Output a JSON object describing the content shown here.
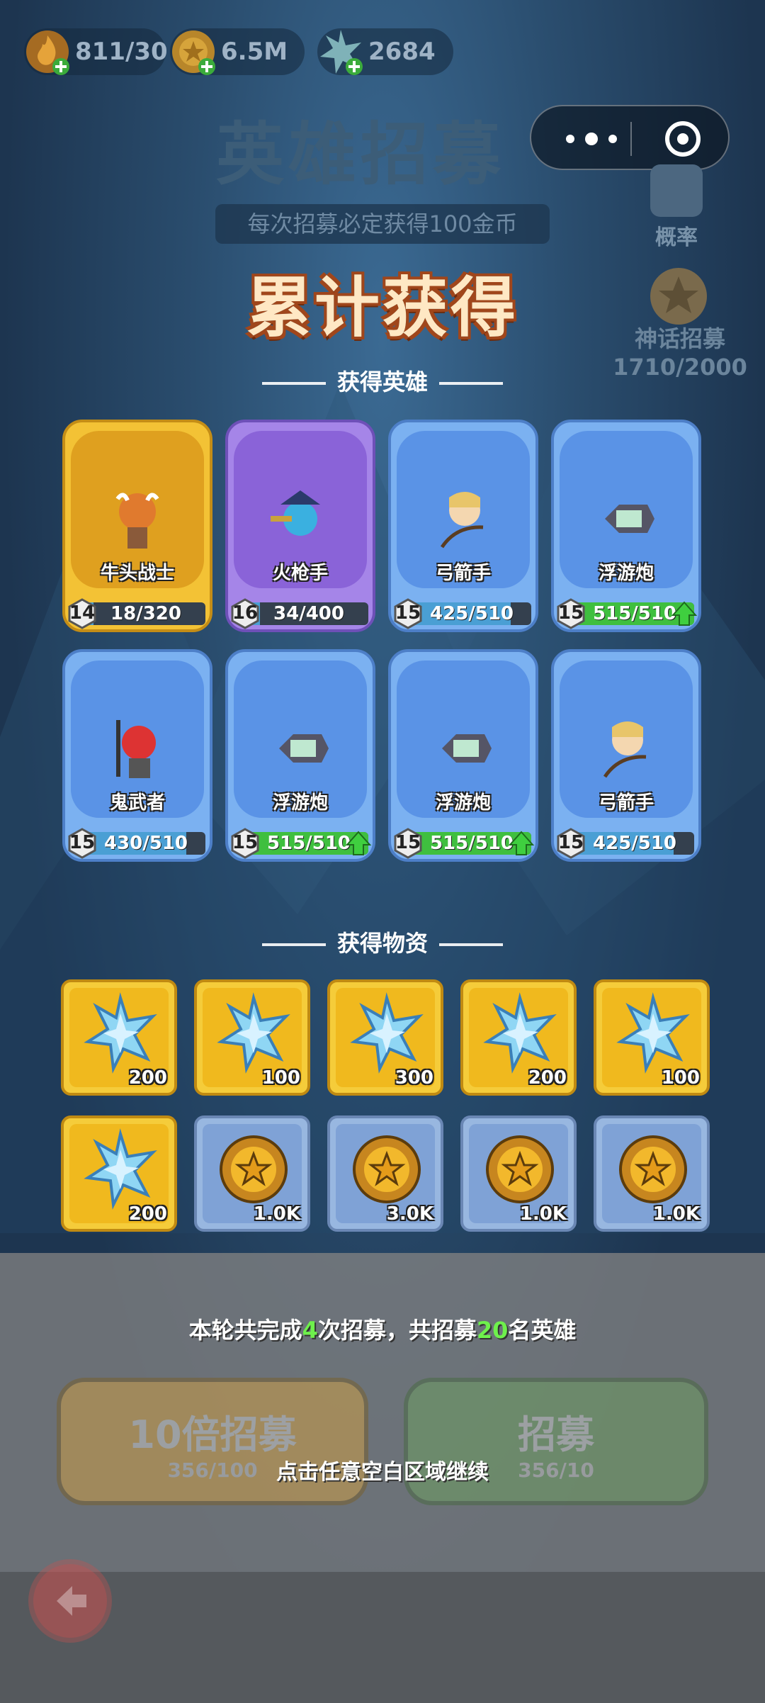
{
  "resources": {
    "stamina": "811/30",
    "coins": "6.5M",
    "crystals": "2684"
  },
  "background": {
    "title": "英雄招募",
    "subtitle": "每次招募必定获得100金币",
    "prob_label": "概率",
    "mythic_label": "神话招募",
    "mythic_progress": "1710/2000"
  },
  "main_title": "累计获得",
  "heroes_section": "获得英雄",
  "items_section": "获得物资",
  "heroes": [
    {
      "name": "牛头战士",
      "level": "14",
      "progress": "18/320",
      "fill": 0.06,
      "rarity": "gold",
      "upgrade": false
    },
    {
      "name": "火枪手",
      "level": "16",
      "progress": "34/400",
      "fill": 0.09,
      "rarity": "purple",
      "upgrade": false
    },
    {
      "name": "弓箭手",
      "level": "15",
      "progress": "425/510",
      "fill": 0.83,
      "rarity": "blue",
      "upgrade": false
    },
    {
      "name": "浮游炮",
      "level": "15",
      "progress": "515/510",
      "fill": 1.0,
      "rarity": "blue",
      "upgrade": true
    },
    {
      "name": "鬼武者",
      "level": "15",
      "progress": "430/510",
      "fill": 0.84,
      "rarity": "blue",
      "upgrade": false
    },
    {
      "name": "浮游炮",
      "level": "15",
      "progress": "515/510",
      "fill": 1.0,
      "rarity": "blue",
      "upgrade": true
    },
    {
      "name": "浮游炮",
      "level": "15",
      "progress": "515/510",
      "fill": 1.0,
      "rarity": "blue",
      "upgrade": true
    },
    {
      "name": "弓箭手",
      "level": "15",
      "progress": "425/510",
      "fill": 0.83,
      "rarity": "blue",
      "upgrade": false
    }
  ],
  "items": [
    {
      "type": "crystal",
      "qty": "200",
      "tile": "gold"
    },
    {
      "type": "crystal",
      "qty": "100",
      "tile": "gold"
    },
    {
      "type": "crystal",
      "qty": "300",
      "tile": "gold"
    },
    {
      "type": "crystal",
      "qty": "200",
      "tile": "gold"
    },
    {
      "type": "crystal",
      "qty": "100",
      "tile": "gold"
    },
    {
      "type": "crystal",
      "qty": "200",
      "tile": "gold"
    },
    {
      "type": "coin",
      "qty": "1.0K",
      "tile": "blue"
    },
    {
      "type": "coin",
      "qty": "3.0K",
      "tile": "blue"
    },
    {
      "type": "coin",
      "qty": "1.0K",
      "tile": "blue"
    },
    {
      "type": "coin",
      "qty": "1.0K",
      "tile": "blue"
    }
  ],
  "summary": {
    "prefix": "本轮共完成",
    "count": "4",
    "middle": "次招募，共招募",
    "heroes": "20",
    "suffix": "名英雄"
  },
  "buttons": {
    "left_label": "10倍招募",
    "left_cost": "356/100",
    "right_label": "招募",
    "right_cost": "356/10"
  },
  "continue_hint": "点击任意空白区域继续",
  "colors": {
    "highlight": "#6ef04c",
    "title_fill": "#ffe8c4",
    "title_outline": "#a0461b"
  }
}
